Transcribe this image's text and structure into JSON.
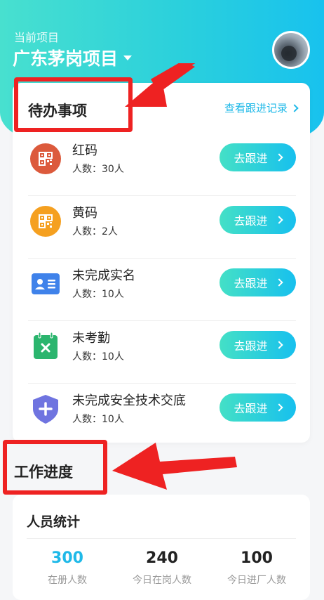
{
  "header": {
    "project_label": "当前项目",
    "project_name": "广东茅岗项目"
  },
  "todo": {
    "title": "待办事项",
    "history_link": "查看跟进记录",
    "items": [
      {
        "name": "红码",
        "count": "人数：30人",
        "button": "去跟进",
        "icon": "qr-code-icon",
        "color": "#dc5a3c"
      },
      {
        "name": "黄码",
        "count": "人数：2人",
        "button": "去跟进",
        "icon": "qr-code-icon",
        "color": "#f5a020"
      },
      {
        "name": "未完成实名",
        "count": "人数：10人",
        "button": "去跟进",
        "icon": "id-card-icon",
        "color": "#3f82ea"
      },
      {
        "name": "未考勤",
        "count": "人数：10人",
        "button": "去跟进",
        "icon": "calendar-x-icon",
        "color": "#2bb56e"
      },
      {
        "name": "未完成安全技术交底",
        "count": "人数：10人",
        "button": "去跟进",
        "icon": "shield-plus-icon",
        "color": "#6f74e0"
      }
    ]
  },
  "progress": {
    "title": "工作进度",
    "stats_title": "人员统计",
    "stats": [
      {
        "value": "300",
        "label": "在册人数"
      },
      {
        "value": "240",
        "label": "今日在岗人数"
      },
      {
        "value": "100",
        "label": "今日进厂人数"
      }
    ]
  },
  "colors": {
    "accent": "#1fb9e8",
    "gradient_start": "#44e0c6",
    "gradient_end": "#17c0ee",
    "annotation_red": "#ee2222"
  }
}
